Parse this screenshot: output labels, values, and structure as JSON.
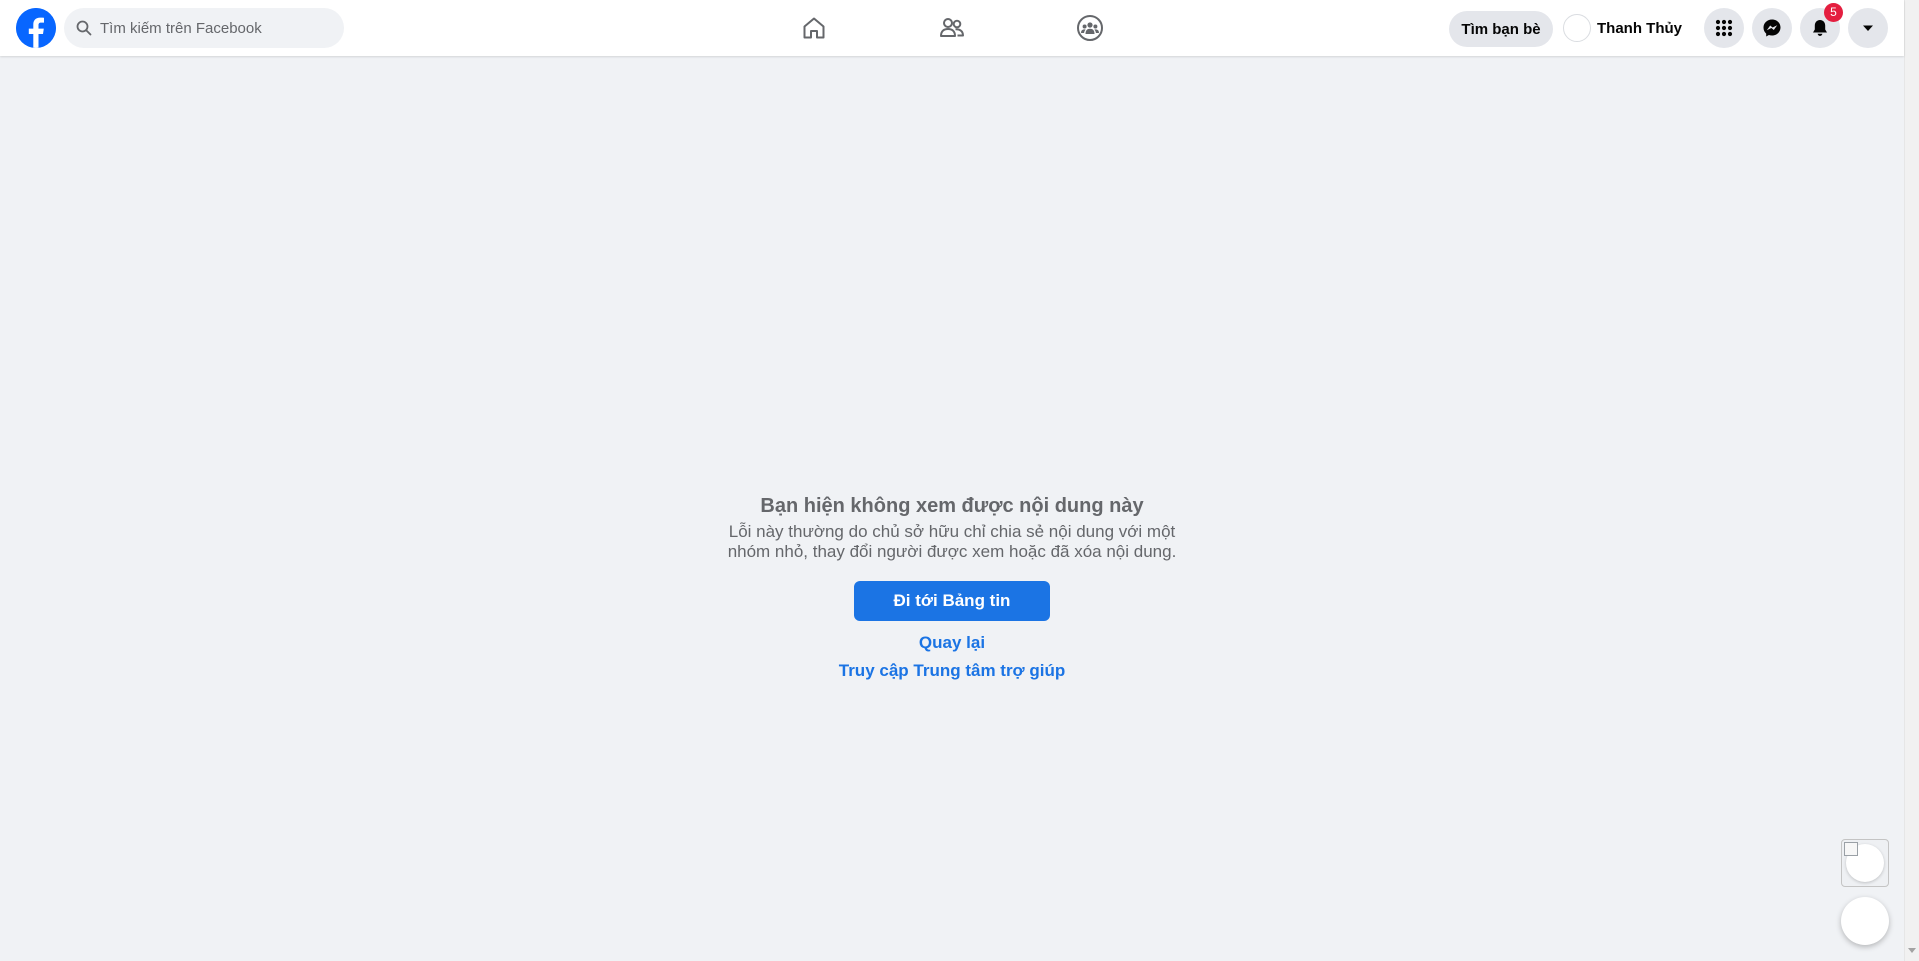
{
  "header": {
    "search": {
      "placeholder": "Tìm kiếm trên Facebook",
      "value": ""
    },
    "nav": [
      {
        "name": "home",
        "icon": "home-icon"
      },
      {
        "name": "friends",
        "icon": "friends-icon"
      },
      {
        "name": "groups",
        "icon": "groups-icon"
      }
    ],
    "find_friends_label": "Tìm bạn bè",
    "profile_name": "Thanh Thủy",
    "notification_count": "5",
    "icons": {
      "menu": "grid-menu-icon",
      "messenger": "messenger-icon",
      "notifications": "bell-icon",
      "account": "caret-down-icon"
    }
  },
  "content": {
    "title": "Bạn hiện không xem được nội dung này",
    "description": "Lỗi này thường do chủ sở hữu chỉ chia sẻ nội dung với một nhóm nhỏ, thay đổi người được xem hoặc đã xóa nội dung.",
    "primary_button": "Đi tới Bảng tin",
    "back_link": "Quay lại",
    "help_link": "Truy cập Trung tâm trợ giúp"
  },
  "colors": {
    "brand": "#0866ff",
    "accent": "#1b74e4",
    "background": "#f0f2f5",
    "badge": "#e41e3f",
    "muted_text": "#65676b"
  }
}
